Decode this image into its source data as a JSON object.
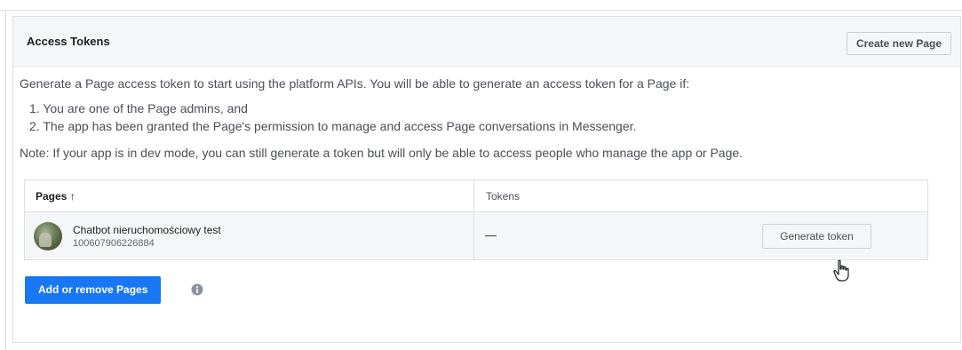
{
  "header": {
    "title": "Access Tokens",
    "create_button": "Create new Page"
  },
  "description": {
    "intro": "Generate a Page access token to start using the platform APIs. You will be able to generate an access token for a Page if:",
    "item1": "1. You are one of the Page admins, and",
    "item2": "2. The app has been granted the Page's permission to manage and access Page conversations in Messenger.",
    "note": "Note: If your app is in dev mode, you can still generate a token but will only be able to access people who manage the app or Page."
  },
  "table": {
    "col_pages": "Pages ↑",
    "col_tokens": "Tokens",
    "rows": [
      {
        "page_name": "Chatbot nieruchomościowy test",
        "page_id": "100607906226884",
        "token": "—",
        "action": "Generate token"
      }
    ]
  },
  "footer": {
    "add_button": "Add or remove Pages",
    "info_icon": "info-icon"
  },
  "colors": {
    "primary": "#1877f2",
    "header_bg": "#f5f6f7",
    "border": "#dddfe2"
  }
}
